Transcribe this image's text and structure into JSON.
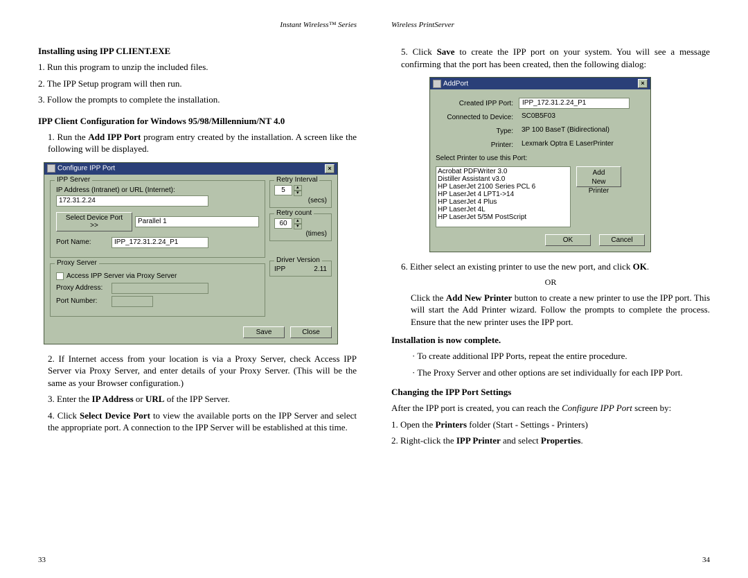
{
  "left": {
    "series_header": "Instant Wireless™ Series",
    "h1": "Installing using IPP CLIENT.EXE",
    "step1": "1. Run this program to unzip the included files.",
    "step2": "2. The IPP Setup program will then run.",
    "step3": "3. Follow the prompts to complete the installation.",
    "h2": "IPP Client Configuration for Windows 95/98/Millennium/NT 4.0",
    "cfg_step1_a": "1. Run the ",
    "cfg_step1_b": "Add IPP Port",
    "cfg_step1_c": " program entry created by the installation. A screen like the following will be displayed.",
    "dialog": {
      "title": "Configure IPP Port",
      "group_ipp": "IPP Server",
      "ip_label": "IP Address (Intranet) or URL (Internet):",
      "ip_value": "172.31.2.24",
      "select_port_btn": "Select Device Port >>",
      "select_port_val": "Parallel 1",
      "port_name_lbl": "Port Name:",
      "port_name_val": "IPP_172.31.2.24_P1",
      "group_retry_interval": "Retry Interval",
      "retry_interval_val": "5",
      "secs": "(secs)",
      "group_retry_count": "Retry count",
      "retry_count_val": "60",
      "times": "(times)",
      "group_proxy": "Proxy Server",
      "proxy_chk": "Access IPP Server via Proxy Server",
      "proxy_addr_lbl": "Proxy Address:",
      "proxy_port_lbl": "Port Number:",
      "group_driver": "Driver Version",
      "driver_ipp_lbl": "IPP",
      "driver_ipp_val": "2.11",
      "save_btn": "Save",
      "close_btn": "Close"
    },
    "cfg_step2": "2. If Internet access from your location is via a Proxy Server, check Access IPP Server via Proxy Server, and enter details of your Proxy Server. (This will be the same as your Browser configuration.)",
    "cfg_step3_a": "3. Enter the ",
    "cfg_step3_b": "IP Address",
    "cfg_step3_c": " or ",
    "cfg_step3_d": "URL",
    "cfg_step3_e": " of the IPP Server.",
    "cfg_step4_a": "4. Click ",
    "cfg_step4_b": "Select Device Port",
    "cfg_step4_c": " to view the available ports on the IPP Server and select the appropriate port. A connection to the IPP Server will be established at this time.",
    "pagenum": "33"
  },
  "right": {
    "series_header": "Wireless PrintServer",
    "step5_a": "5. Click ",
    "step5_b": "Save",
    "step5_c": " to create the IPP port on your system. You will see a message confirming that the port has been created, then the following dialog:",
    "dialog": {
      "title": "AddPort",
      "created_lbl": "Created IPP Port:",
      "created_val": "IPP_172.31.2.24_P1",
      "connected_lbl": "Connected to Device:",
      "connected_val": "SC0B5F03",
      "type_lbl": "Type:",
      "type_val": "3P 100 BaseT (Bidirectional)",
      "printer_lbl": "Printer:",
      "printer_val": "Lexmark Optra E LaserPrinter",
      "select_lbl": "Select Printer to use this Port:",
      "list": [
        "Acrobat PDFWriter 3.0",
        "Distiller Assistant v3.0",
        "HP LaserJet 2100 Series PCL 6",
        "HP LaserJet 4 LPT1->14",
        "HP LaserJet 4 Plus",
        "HP LaserJet 4L",
        "HP LaserJet 5/5M PostScript"
      ],
      "add_btn": "Add\nNew Printer",
      "ok_btn": "OK",
      "cancel_btn": "Cancel"
    },
    "step6_a": "6. Either select an existing printer to use the new port, and click ",
    "step6_b": "OK",
    "step6_c": ".",
    "or": "OR",
    "step6_d_a": "Click the ",
    "step6_d_b": "Add New Printer",
    "step6_d_c": " button to create a new printer to use the IPP port. This will start the Add Printer wizard. Follow the prompts to complete the process. Ensure that the new printer uses the IPP port.",
    "h_complete": "Installation is now complete.",
    "bullet1": "· To create additional IPP Ports, repeat the entire procedure.",
    "bullet2": "· The Proxy Server and other options are set individually for each IPP Port.",
    "h_change": "Changing the IPP Port Settings",
    "change_intro_a": "After the IPP port is created, you can reach the ",
    "change_intro_b": "Configure IPP Port",
    "change_intro_c": " screen by:",
    "change_1_a": "1. Open the ",
    "change_1_b": "Printers",
    "change_1_c": " folder (Start - Settings - Printers)",
    "change_2_a": "2. Right-click the ",
    "change_2_b": "IPP Printer",
    "change_2_c": " and select ",
    "change_2_d": "Properties",
    "change_2_e": ".",
    "pagenum": "34"
  }
}
